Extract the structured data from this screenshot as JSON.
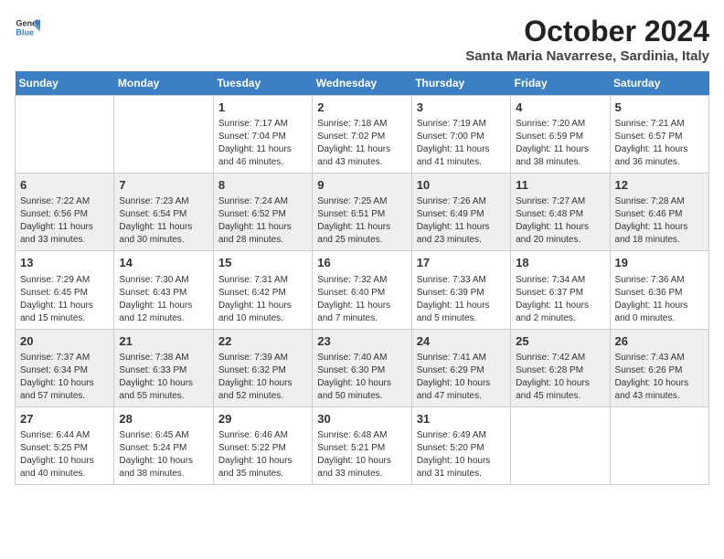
{
  "header": {
    "logo_general": "General",
    "logo_blue": "Blue",
    "month_title": "October 2024",
    "subtitle": "Santa Maria Navarrese, Sardinia, Italy"
  },
  "calendar": {
    "days_of_week": [
      "Sunday",
      "Monday",
      "Tuesday",
      "Wednesday",
      "Thursday",
      "Friday",
      "Saturday"
    ],
    "weeks": [
      [
        {
          "day": "",
          "info": ""
        },
        {
          "day": "",
          "info": ""
        },
        {
          "day": "1",
          "info": "Sunrise: 7:17 AM\nSunset: 7:04 PM\nDaylight: 11 hours and 46 minutes."
        },
        {
          "day": "2",
          "info": "Sunrise: 7:18 AM\nSunset: 7:02 PM\nDaylight: 11 hours and 43 minutes."
        },
        {
          "day": "3",
          "info": "Sunrise: 7:19 AM\nSunset: 7:00 PM\nDaylight: 11 hours and 41 minutes."
        },
        {
          "day": "4",
          "info": "Sunrise: 7:20 AM\nSunset: 6:59 PM\nDaylight: 11 hours and 38 minutes."
        },
        {
          "day": "5",
          "info": "Sunrise: 7:21 AM\nSunset: 6:57 PM\nDaylight: 11 hours and 36 minutes."
        }
      ],
      [
        {
          "day": "6",
          "info": "Sunrise: 7:22 AM\nSunset: 6:56 PM\nDaylight: 11 hours and 33 minutes."
        },
        {
          "day": "7",
          "info": "Sunrise: 7:23 AM\nSunset: 6:54 PM\nDaylight: 11 hours and 30 minutes."
        },
        {
          "day": "8",
          "info": "Sunrise: 7:24 AM\nSunset: 6:52 PM\nDaylight: 11 hours and 28 minutes."
        },
        {
          "day": "9",
          "info": "Sunrise: 7:25 AM\nSunset: 6:51 PM\nDaylight: 11 hours and 25 minutes."
        },
        {
          "day": "10",
          "info": "Sunrise: 7:26 AM\nSunset: 6:49 PM\nDaylight: 11 hours and 23 minutes."
        },
        {
          "day": "11",
          "info": "Sunrise: 7:27 AM\nSunset: 6:48 PM\nDaylight: 11 hours and 20 minutes."
        },
        {
          "day": "12",
          "info": "Sunrise: 7:28 AM\nSunset: 6:46 PM\nDaylight: 11 hours and 18 minutes."
        }
      ],
      [
        {
          "day": "13",
          "info": "Sunrise: 7:29 AM\nSunset: 6:45 PM\nDaylight: 11 hours and 15 minutes."
        },
        {
          "day": "14",
          "info": "Sunrise: 7:30 AM\nSunset: 6:43 PM\nDaylight: 11 hours and 12 minutes."
        },
        {
          "day": "15",
          "info": "Sunrise: 7:31 AM\nSunset: 6:42 PM\nDaylight: 11 hours and 10 minutes."
        },
        {
          "day": "16",
          "info": "Sunrise: 7:32 AM\nSunset: 6:40 PM\nDaylight: 11 hours and 7 minutes."
        },
        {
          "day": "17",
          "info": "Sunrise: 7:33 AM\nSunset: 6:39 PM\nDaylight: 11 hours and 5 minutes."
        },
        {
          "day": "18",
          "info": "Sunrise: 7:34 AM\nSunset: 6:37 PM\nDaylight: 11 hours and 2 minutes."
        },
        {
          "day": "19",
          "info": "Sunrise: 7:36 AM\nSunset: 6:36 PM\nDaylight: 11 hours and 0 minutes."
        }
      ],
      [
        {
          "day": "20",
          "info": "Sunrise: 7:37 AM\nSunset: 6:34 PM\nDaylight: 10 hours and 57 minutes."
        },
        {
          "day": "21",
          "info": "Sunrise: 7:38 AM\nSunset: 6:33 PM\nDaylight: 10 hours and 55 minutes."
        },
        {
          "day": "22",
          "info": "Sunrise: 7:39 AM\nSunset: 6:32 PM\nDaylight: 10 hours and 52 minutes."
        },
        {
          "day": "23",
          "info": "Sunrise: 7:40 AM\nSunset: 6:30 PM\nDaylight: 10 hours and 50 minutes."
        },
        {
          "day": "24",
          "info": "Sunrise: 7:41 AM\nSunset: 6:29 PM\nDaylight: 10 hours and 47 minutes."
        },
        {
          "day": "25",
          "info": "Sunrise: 7:42 AM\nSunset: 6:28 PM\nDaylight: 10 hours and 45 minutes."
        },
        {
          "day": "26",
          "info": "Sunrise: 7:43 AM\nSunset: 6:26 PM\nDaylight: 10 hours and 43 minutes."
        }
      ],
      [
        {
          "day": "27",
          "info": "Sunrise: 6:44 AM\nSunset: 5:25 PM\nDaylight: 10 hours and 40 minutes."
        },
        {
          "day": "28",
          "info": "Sunrise: 6:45 AM\nSunset: 5:24 PM\nDaylight: 10 hours and 38 minutes."
        },
        {
          "day": "29",
          "info": "Sunrise: 6:46 AM\nSunset: 5:22 PM\nDaylight: 10 hours and 35 minutes."
        },
        {
          "day": "30",
          "info": "Sunrise: 6:48 AM\nSunset: 5:21 PM\nDaylight: 10 hours and 33 minutes."
        },
        {
          "day": "31",
          "info": "Sunrise: 6:49 AM\nSunset: 5:20 PM\nDaylight: 10 hours and 31 minutes."
        },
        {
          "day": "",
          "info": ""
        },
        {
          "day": "",
          "info": ""
        }
      ]
    ]
  }
}
